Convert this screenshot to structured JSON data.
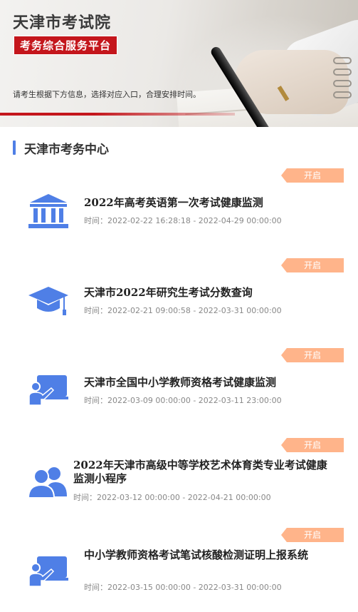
{
  "header": {
    "title": "天津市考试院",
    "subtitle": "考务综合服务平台",
    "hint": "请考生根据下方信息，选择对应入口，合理安排时间。"
  },
  "section": {
    "title": "天津市考务中心"
  },
  "time_label": "时间：",
  "accent_color": "#4f7fe6",
  "badge_color": "#ffb48a",
  "items": [
    {
      "title": "2022年高考英语第一次考试健康监测",
      "status": "开启",
      "time": "2022-02-22 16:28:18 - 2022-04-29 00:00:00",
      "icon": "museum-icon"
    },
    {
      "title": "天津市2022年研究生考试分数查询",
      "status": "开启",
      "time": "2022-02-21 09:00:58 - 2022-03-31 00:00:00",
      "icon": "graduation-cap-icon"
    },
    {
      "title": "天津市全国中小学教师资格考试健康监测",
      "status": "开启",
      "time": "2022-03-09 00:00:00 - 2022-03-11 23:00:00",
      "icon": "teacher-board-icon"
    },
    {
      "title": "2022年天津市高级中等学校艺术体育类专业考试健康监测小程序",
      "status": "开启",
      "time": "2022-03-12 00:00:00 - 2022-04-21 00:00:00",
      "icon": "users-icon"
    },
    {
      "title": "中小学教师资格考试笔试核酸检测证明上报系统",
      "status": "开启",
      "time": "2022-03-15 00:00:00 - 2022-03-31 00:00:00",
      "icon": "teacher-board-icon"
    }
  ]
}
